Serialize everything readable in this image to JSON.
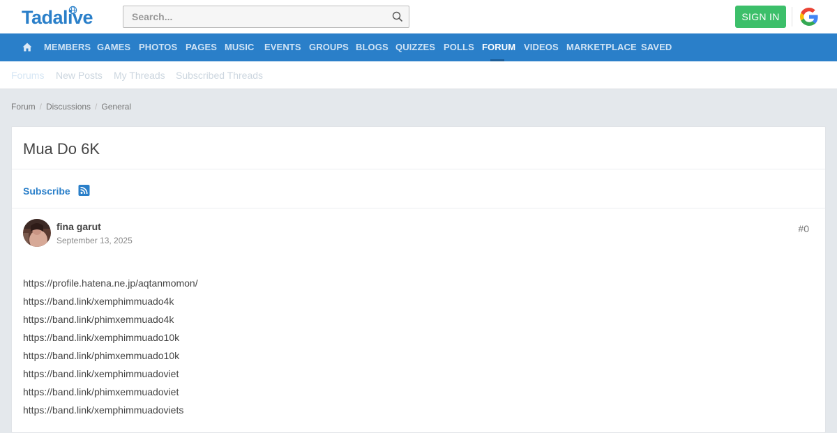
{
  "header": {
    "logo_text": "Tadalive",
    "search_placeholder": "Search...",
    "signin_label": "SIGN IN"
  },
  "nav": {
    "items": [
      "MEMBERS",
      "GAMES",
      "PHOTOS",
      "PAGES",
      "MUSIC",
      "EVENTS",
      "GROUPS",
      "BLOGS",
      "QUIZZES",
      "POLLS",
      "FORUM",
      "VIDEOS",
      "MARKETPLACE",
      "SAVED"
    ],
    "active": "FORUM"
  },
  "subnav": {
    "items": [
      "Forums",
      "New Posts",
      "My Threads",
      "Subscribed Threads"
    ]
  },
  "breadcrumb": [
    "Forum",
    "Discussions",
    "General"
  ],
  "thread": {
    "title": "Mua Do 6K",
    "subscribe_label": "Subscribe"
  },
  "post": {
    "author": "fina garut",
    "date": "September 13, 2025",
    "number": "#0",
    "lines": [
      "https://profile.hatena.ne.jp/aqtanmomon/",
      "https://band.link/xemphimmuado4k",
      "https://band.link/phimxemmuado4k",
      "https://band.link/xemphimmuado10k",
      "https://band.link/phimxemmuado10k",
      "https://band.link/xemphimmuadoviet",
      "https://band.link/phimxemmuadoviet",
      "https://band.link/xemphimmuadoviets"
    ]
  },
  "colors": {
    "brand": "#2a7fc9",
    "signin": "#3cbf6a",
    "background": "#e4e8ec"
  },
  "icons": {
    "home": "home-icon",
    "search": "search-icon",
    "rss": "rss-icon",
    "google": "google-icon"
  }
}
